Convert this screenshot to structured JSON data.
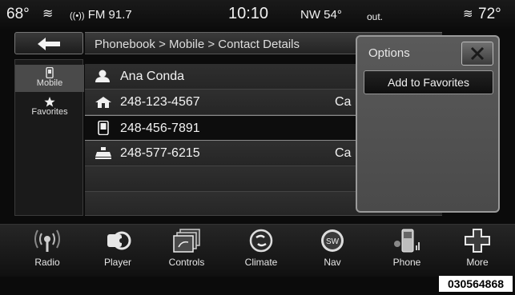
{
  "status": {
    "temp_left": "68°",
    "radio": "FM 91.7",
    "time": "10:10",
    "compass": "NW 54°",
    "outside_label": "out.",
    "temp_right": "72°"
  },
  "header": {
    "breadcrumb": "Phonebook > Mobile > Contact Details"
  },
  "sidebar": {
    "items": [
      {
        "label": "Mobile",
        "icon": "mobile-phone-icon",
        "selected": true
      },
      {
        "label": "Favorites",
        "icon": "star-icon",
        "selected": false
      }
    ]
  },
  "contact": {
    "name": "Ana Conda",
    "numbers": [
      {
        "number": "248-123-4567",
        "type_icon": "home-icon",
        "call_label": "Ca"
      },
      {
        "number": "248-456-7891",
        "type_icon": "mobile-phone-icon",
        "call_label": ""
      },
      {
        "number": "248-577-6215",
        "type_icon": "work-icon",
        "call_label": "Ca"
      }
    ]
  },
  "options": {
    "title": "Options",
    "add_favorites": "Add to Favorites"
  },
  "dock": {
    "items": [
      {
        "label": "Radio",
        "icon": "radio-icon"
      },
      {
        "label": "Player",
        "icon": "player-icon"
      },
      {
        "label": "Controls",
        "icon": "controls-icon"
      },
      {
        "label": "Climate",
        "icon": "climate-icon"
      },
      {
        "label": "Nav",
        "icon": "nav-icon"
      },
      {
        "label": "Phone",
        "icon": "phone-icon"
      },
      {
        "label": "More",
        "icon": "more-icon"
      }
    ]
  },
  "figure_code": "030564868"
}
